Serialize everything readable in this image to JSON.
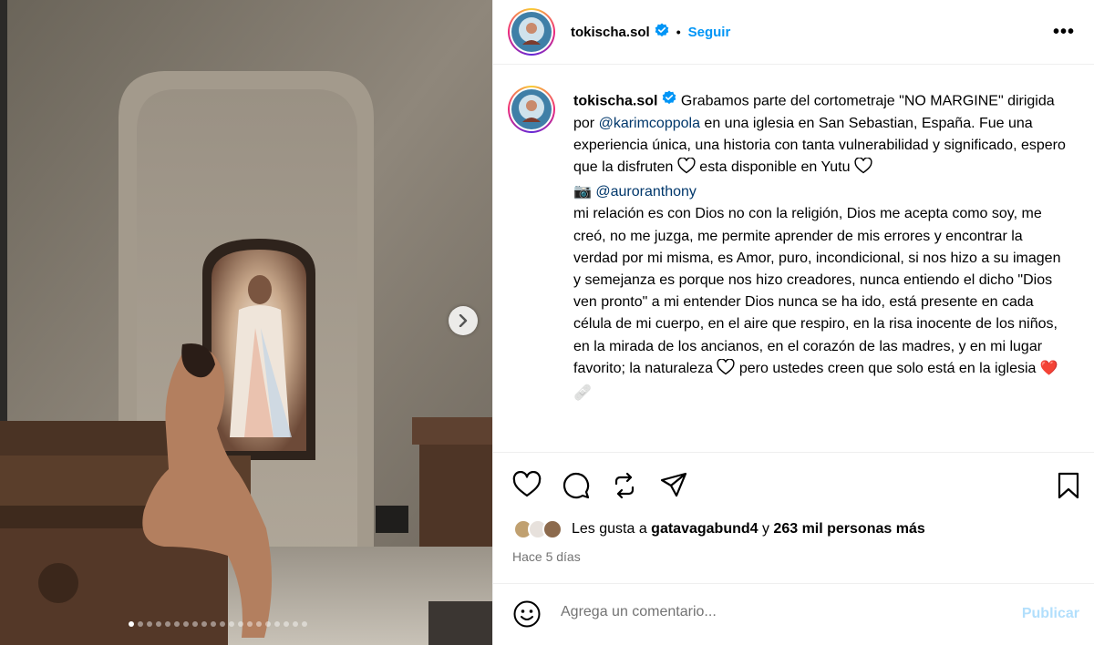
{
  "post": {
    "username": "tokischa.sol",
    "follow_label": "Seguir",
    "separator": "•",
    "more_label": "•••"
  },
  "caption": {
    "username": "tokischa.sol",
    "part1": " Grabamos parte del cortometraje \"NO MARGINE\" dirigida por ",
    "mention1": "@karimcoppola",
    "part2": " en una iglesia en San Sebastian, España. Fue una experiencia única, una historia con tanta vulnerabilidad y significado, espero que la disfruten ",
    "part3": " esta disponible en Yutu ",
    "camera": "📷",
    "mention2": "@auroranthony",
    "part4": "mi relación es con Dios no con la religión, Dios me acepta como soy, me creó, no me juzga, me permite aprender de mis errores y encontrar la verdad por mi misma, es Amor, puro, incondicional, si nos hizo a su imagen y semejanza es porque nos hizo creadores, nunca entiendo el dicho \"Dios ven pronto\" a mi entender Dios nunca se ha ido, está presente en cada célula de mi cuerpo, en el aire que respiro, en la risa inocente de los niños, en la mirada de los ancianos, en el corazón de las madres, y en mi lugar favorito; la naturaleza ",
    "part5": " pero ustedes creen que solo está en la iglesia ",
    "end_emoji": "❤️🩹"
  },
  "likes": {
    "prefix": "Les gusta a ",
    "user": "gatavagabund4",
    "middle": " y ",
    "count": "263 mil personas más"
  },
  "timestamp": "Hace 5 días",
  "comment": {
    "placeholder": "Agrega un comentario...",
    "publish_label": "Publicar"
  },
  "carousel": {
    "slide_count": 20,
    "active_index": 0
  },
  "colors": {
    "link": "#0095f6",
    "mention": "#00376b",
    "verified": "#0095f6",
    "publish_disabled": "#b2dffc",
    "muted": "#737373"
  },
  "icons": [
    "chevron-right-icon",
    "verified-icon",
    "heart-icon",
    "comment-icon",
    "repost-icon",
    "share-icon",
    "bookmark-icon",
    "emoji-icon",
    "more-icon"
  ]
}
